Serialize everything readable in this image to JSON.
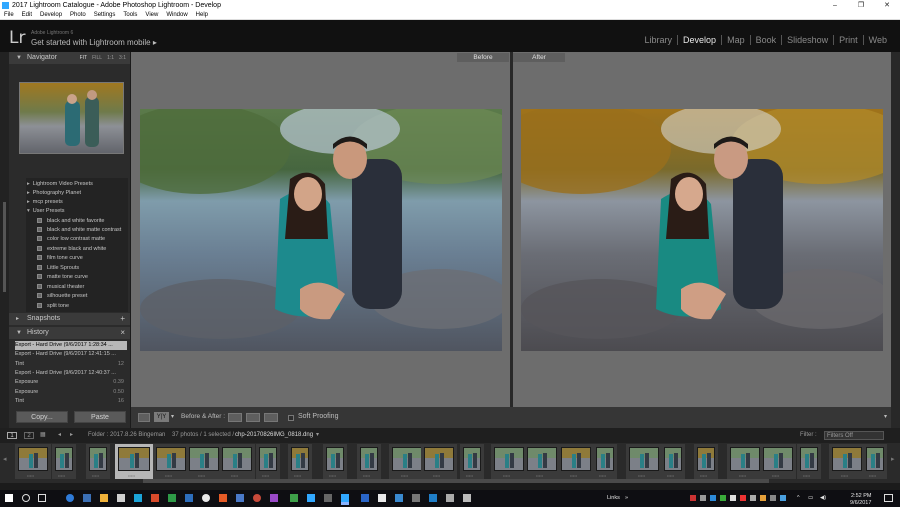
{
  "titlebar": {
    "title": "2017 Lightroom Catalogue - Adobe Photoshop Lightroom - Develop",
    "minimize": "–",
    "maximize": "❐",
    "close": "✕"
  },
  "menu": [
    "File",
    "Edit",
    "Develop",
    "Photo",
    "Settings",
    "Tools",
    "View",
    "Window",
    "Help"
  ],
  "identity": {
    "logo": "Lr",
    "small": "Adobe Lightroom 6",
    "main": "Get started with Lightroom mobile ▸"
  },
  "modules": [
    "Library",
    "Develop",
    "Map",
    "Book",
    "Slideshow",
    "Print",
    "Web"
  ],
  "active_module": "Develop",
  "navigator": {
    "title": "Navigator",
    "zoom_options": [
      "FIT",
      "FILL",
      "1:1",
      "3:1"
    ]
  },
  "presets": {
    "folders": [
      "Lightroom Video Presets",
      "Photography Planet",
      "mcp presets",
      "User Presets"
    ],
    "user_presets": [
      "black and white favorite",
      "black and white matte contrast",
      "color low contrast matte",
      "extreme black and white",
      "film tone curve",
      "Little Sprouts",
      "matte tone curve",
      "musical theater",
      "silhouette preset",
      "split tone"
    ]
  },
  "snapshots": {
    "title": "Snapshots",
    "add": "+"
  },
  "history": {
    "title": "History",
    "clear": "×",
    "items": [
      {
        "label": "Export - Hard Drive (9/6/2017 1:28:34 ...",
        "value": ""
      },
      {
        "label": "Export - Hard Drive (9/6/2017 12:41:15 ...",
        "value": ""
      },
      {
        "label": "Tint",
        "value": "12"
      },
      {
        "label": "Export - Hard Drive (9/6/2017 12:40:37 ...",
        "value": ""
      },
      {
        "label": "Exposure",
        "value": "0.39"
      },
      {
        "label": "Exposure",
        "value": "0.50"
      },
      {
        "label": "Tint",
        "value": "16"
      }
    ]
  },
  "buttons": {
    "copy": "Copy...",
    "paste": "Paste"
  },
  "compare": {
    "before": "Before",
    "after": "After"
  },
  "toolbar": {
    "ba_label": "Before & After :",
    "view_mode": "Y|Y",
    "soft_proofing": "Soft Proofing"
  },
  "filmstrip_bar": {
    "page1": "1",
    "page2": "2",
    "folder": "Folder : 2017.8.26 Bingeman",
    "count": "37 photos / 1 selected /",
    "filename": "chp-20170826IMG_0818.dng",
    "filter_label": "Filter :",
    "filter_value": "Filters Off"
  },
  "taskbar": {
    "links": "Links",
    "time": "2:52 PM",
    "date": "9/6/2017"
  }
}
